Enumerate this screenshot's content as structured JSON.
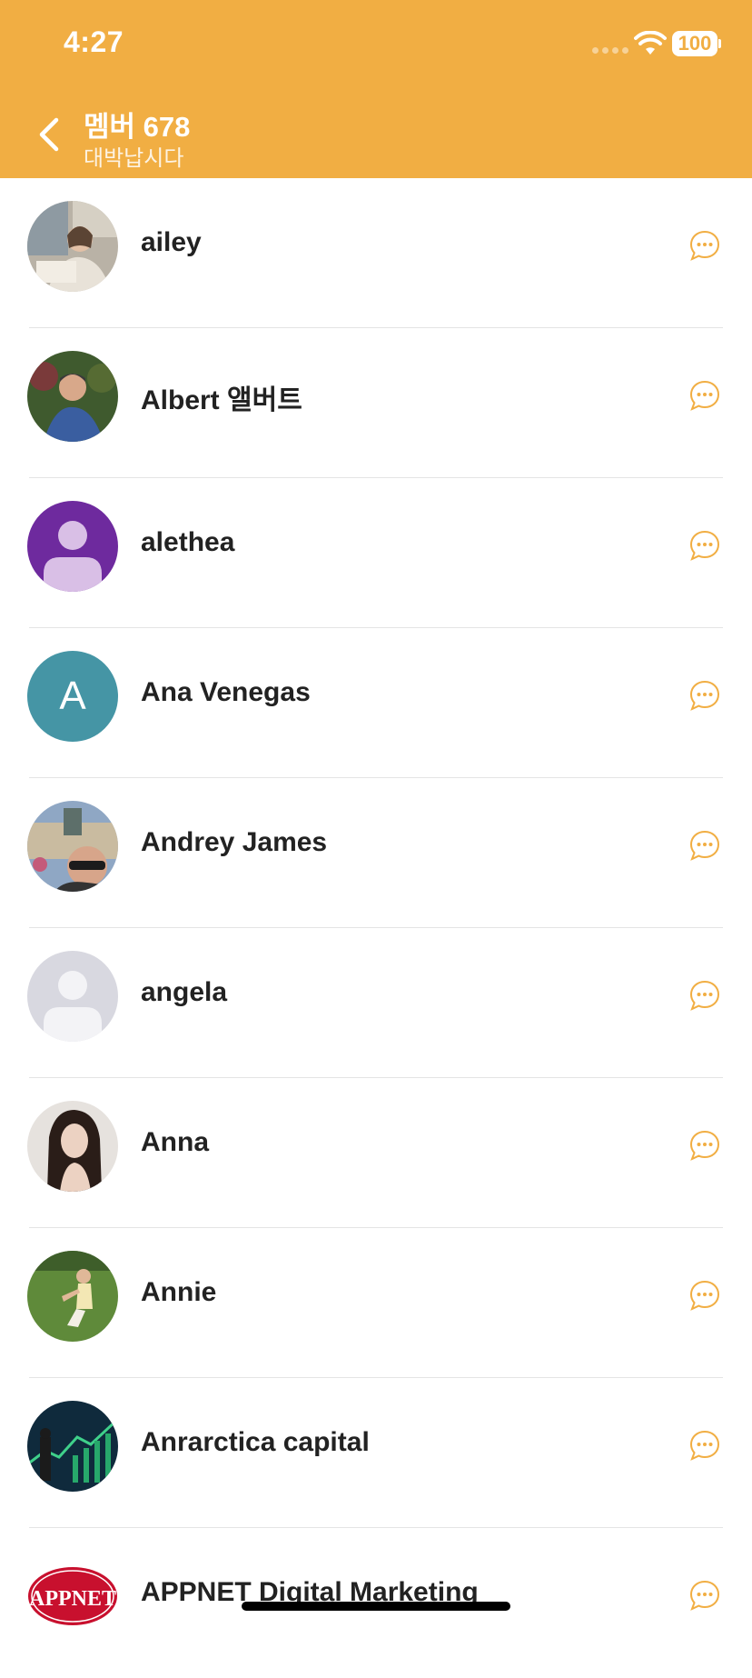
{
  "status_bar": {
    "time": "4:27",
    "battery": "100"
  },
  "header": {
    "title": "멤버 678",
    "subtitle": "대박납시다"
  },
  "members": [
    {
      "name": "ailey",
      "avatar": "photo-woman"
    },
    {
      "name": "Albert 앨버트",
      "avatar": "photo-man-garden"
    },
    {
      "name": "alethea",
      "avatar": "default-person-purple"
    },
    {
      "name": "Ana Venegas",
      "avatar": "initial",
      "initial": "A"
    },
    {
      "name": "Andrey James",
      "avatar": "photo-man-sunglasses"
    },
    {
      "name": "angela",
      "avatar": "default-person-gray"
    },
    {
      "name": "Anna",
      "avatar": "photo-woman-dark"
    },
    {
      "name": "Annie",
      "avatar": "photo-woman-grass"
    },
    {
      "name": "Anrarctica capital",
      "avatar": "photo-city-chart"
    },
    {
      "name": "APPNET Digital Marketing",
      "avatar": "logo-appnet",
      "logo_text": "APPNET"
    }
  ],
  "colors": {
    "accent": "#F1AE43",
    "purple_avatar": "#6E2A9E",
    "teal_avatar": "#4595A5",
    "gray_avatar": "#D8D8E0"
  }
}
